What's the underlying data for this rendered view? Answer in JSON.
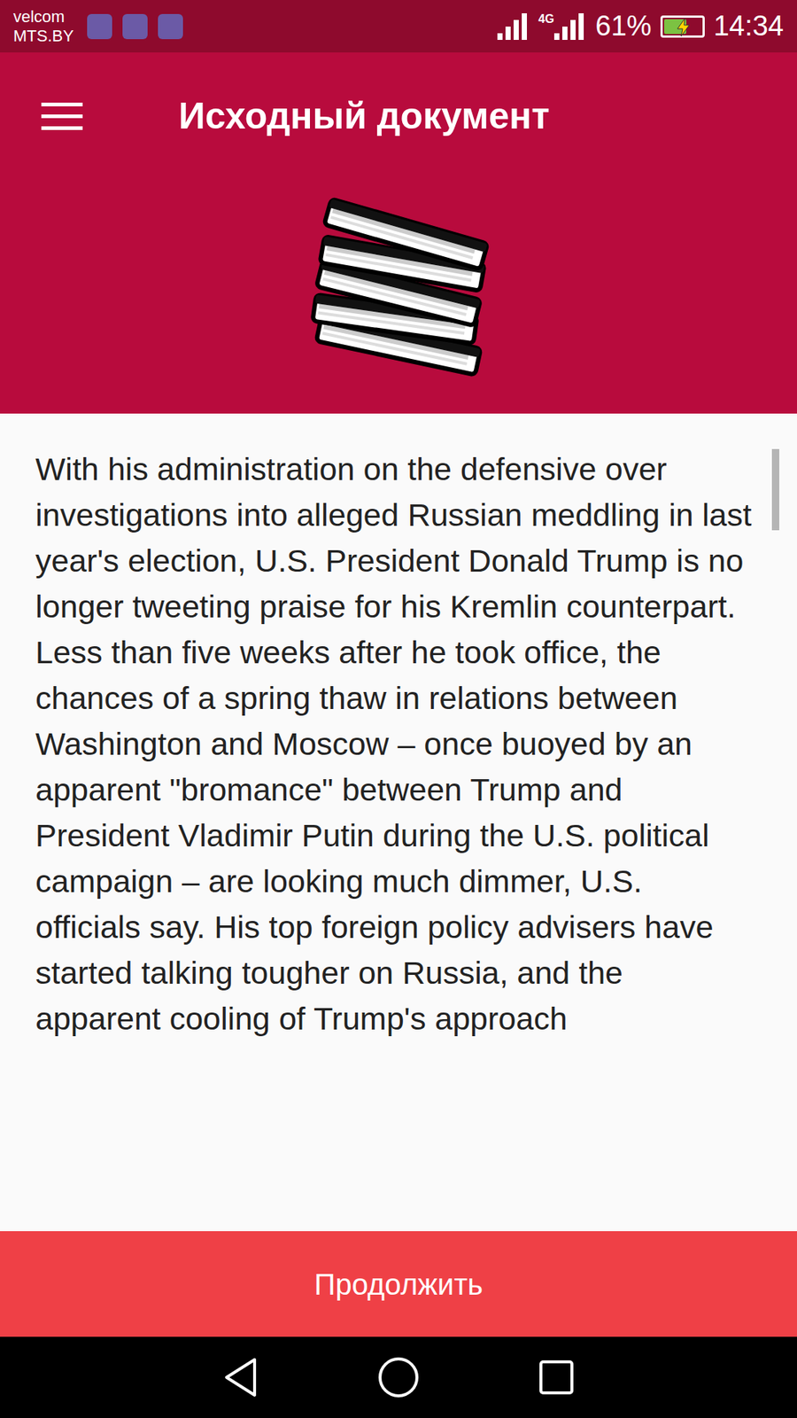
{
  "status_bar": {
    "carriers": [
      "velcom",
      "MTS.BY"
    ],
    "network": "4G",
    "battery": "61%",
    "battery_level": 0.61,
    "charging": true,
    "time": "14:34"
  },
  "header": {
    "title": "Исходный документ"
  },
  "document": {
    "text": "With his administration on the defensive over investigations into alleged Russian meddling in last year's election, U.S. President Donald Trump is no longer tweeting praise for his Kremlin counterpart. Less than five weeks after he took office, the chances of a spring thaw in relations between Washington and Moscow – once buoyed by an apparent \"bromance\" between Trump and President Vladimir Putin during the U.S. political campaign – are looking much dimmer, U.S. officials say. His top foreign policy advisers have started talking tougher on Russia, and the apparent cooling of Trump's approach",
    "scrollbar": {
      "level": 0.11
    }
  },
  "button": {
    "label": "Продолжить"
  }
}
